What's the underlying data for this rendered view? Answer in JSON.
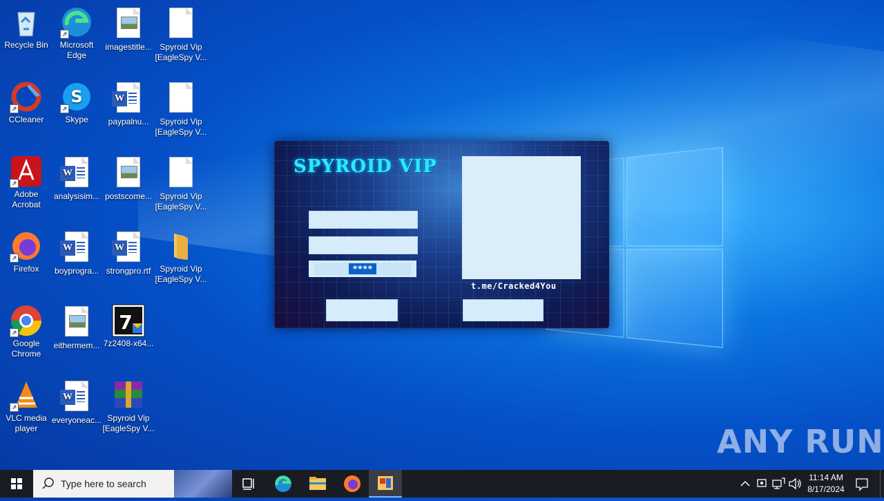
{
  "desktop": {
    "icons": [
      {
        "label": "Recycle Bin"
      },
      {
        "label": "Microsoft Edge"
      },
      {
        "label": "imagestitle..."
      },
      {
        "label": "Spyroid Vip [EagleSpy V..."
      },
      {
        "label": "CCleaner"
      },
      {
        "label": "Skype"
      },
      {
        "label": "paypalnu..."
      },
      {
        "label": "Spyroid Vip [EagleSpy V..."
      },
      {
        "label": "Adobe Acrobat"
      },
      {
        "label": "analysisim..."
      },
      {
        "label": "postscome..."
      },
      {
        "label": "Spyroid Vip [EagleSpy V..."
      },
      {
        "label": "Firefox"
      },
      {
        "label": "boyprogra..."
      },
      {
        "label": "strongpro.rtf"
      },
      {
        "label": "Spyroid Vip [EagleSpy V..."
      },
      {
        "label": "Google Chrome"
      },
      {
        "label": "eithermem..."
      },
      {
        "label": "7z2408-x64..."
      },
      {
        "label": "VLC media player"
      },
      {
        "label": "everyoneac..."
      },
      {
        "label": "Spyroid Vip [EagleSpy V..."
      }
    ]
  },
  "app": {
    "title": "SPYROID VIP",
    "pin_mask": "****",
    "telegram": "t.me/Cracked4You"
  },
  "watermark": "ANY RUN",
  "taskbar": {
    "search_placeholder": "Type here to search",
    "time": "11:14 AM",
    "date": "8/17/2024"
  }
}
